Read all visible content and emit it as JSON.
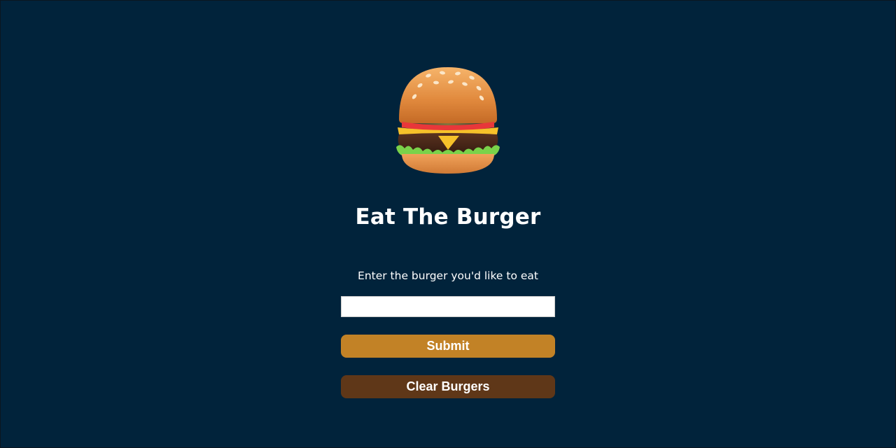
{
  "page": {
    "title": "Eat The Burger",
    "hero_icon": "burger-emoji"
  },
  "form": {
    "prompt_label": "Enter the burger you'd like to eat",
    "input_value": "",
    "input_placeholder": "",
    "submit_label": "Submit",
    "clear_label": "Clear Burgers"
  },
  "colors": {
    "background": "#01233b",
    "submit_button": "#c28226",
    "clear_button": "#5f3718",
    "text": "#ffffff"
  }
}
